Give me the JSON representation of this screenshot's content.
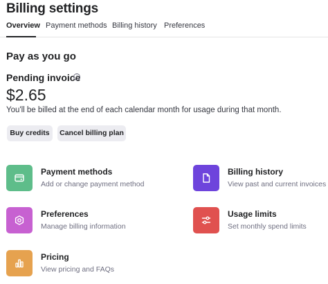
{
  "header": {
    "title": "Billing settings"
  },
  "tabs": [
    {
      "label": "Overview",
      "active": true
    },
    {
      "label": "Payment methods",
      "active": false
    },
    {
      "label": "Billing history",
      "active": false
    },
    {
      "label": "Preferences",
      "active": false
    }
  ],
  "plan": {
    "title": "Pay as you go",
    "pending_label": "Pending invoice",
    "info_glyph": "i",
    "amount": "$2.65",
    "note": "You'll be billed at the end of each calendar month for usage during that month."
  },
  "actions": {
    "buy_credits": "Buy credits",
    "cancel_plan": "Cancel billing plan"
  },
  "cards": {
    "payment_methods": {
      "title": "Payment methods",
      "subtitle": "Add or change payment method",
      "icon": "credit-card-icon",
      "color": "#5ebd8a"
    },
    "billing_history": {
      "title": "Billing history",
      "subtitle": "View past and current invoices",
      "icon": "document-icon",
      "color": "#6e44dc"
    },
    "preferences": {
      "title": "Preferences",
      "subtitle": "Manage billing information",
      "icon": "gear-icon",
      "color": "#c761d1"
    },
    "usage_limits": {
      "title": "Usage limits",
      "subtitle": "Set monthly spend limits",
      "icon": "sliders-icon",
      "color": "#e0514f"
    },
    "pricing": {
      "title": "Pricing",
      "subtitle": "View pricing and FAQs",
      "icon": "bar-chart-icon",
      "color": "#e6a24f"
    }
  }
}
